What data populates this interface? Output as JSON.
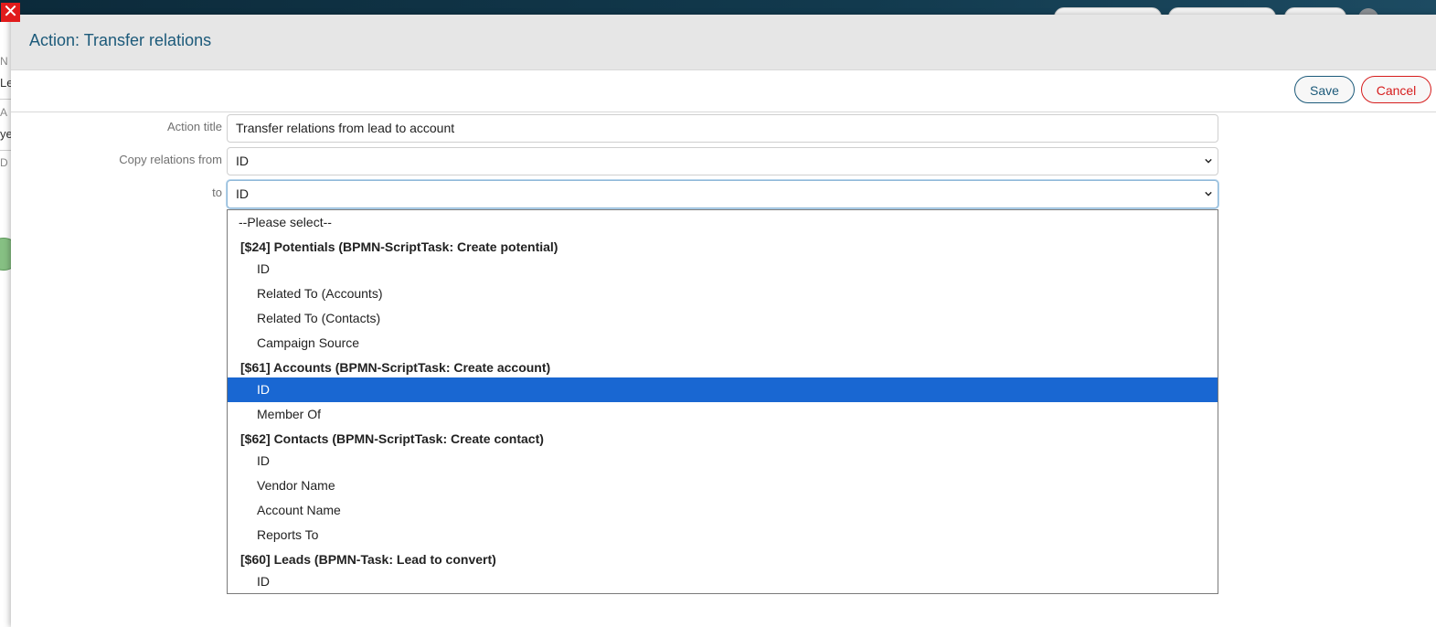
{
  "modal": {
    "title": "Action: Transfer relations",
    "close_label": "✕",
    "save_label": "Save",
    "cancel_label": "Cancel"
  },
  "form": {
    "action_title_label": "Action title",
    "action_title_value": "Transfer relations from lead to account",
    "copy_from_label": "Copy relations from",
    "copy_from_value": "ID",
    "to_label": "to",
    "to_value": "ID"
  },
  "dropdown": {
    "options": [
      {
        "kind": "placeholder",
        "label": "--Please select--"
      },
      {
        "kind": "group",
        "label": "[$24] Potentials (BPMN-ScriptTask: Create potential)"
      },
      {
        "kind": "item",
        "label": "ID"
      },
      {
        "kind": "item",
        "label": "Related To (Accounts)"
      },
      {
        "kind": "item",
        "label": "Related To (Contacts)"
      },
      {
        "kind": "item",
        "label": "Campaign Source"
      },
      {
        "kind": "group",
        "label": "[$61] Accounts (BPMN-ScriptTask: Create account)"
      },
      {
        "kind": "item",
        "label": "ID",
        "selected": true
      },
      {
        "kind": "item",
        "label": "Member Of"
      },
      {
        "kind": "group",
        "label": "[$62] Contacts (BPMN-ScriptTask: Create contact)"
      },
      {
        "kind": "item",
        "label": "ID"
      },
      {
        "kind": "item",
        "label": "Vendor Name"
      },
      {
        "kind": "item",
        "label": "Account Name"
      },
      {
        "kind": "item",
        "label": "Reports To"
      },
      {
        "kind": "group",
        "label": "[$60] Leads (BPMN-Task: Lead to convert)"
      },
      {
        "kind": "item",
        "label": "ID"
      }
    ]
  },
  "background": {
    "left_fragments": [
      "N",
      "Le",
      "A",
      "ye",
      "D"
    ]
  },
  "colors": {
    "accent": "#1c5a7a",
    "danger": "#d61c1c",
    "selection": "#1967d2"
  }
}
